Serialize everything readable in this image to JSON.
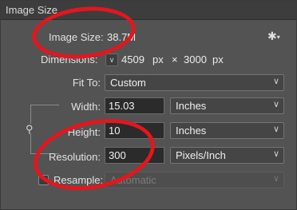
{
  "window": {
    "title": "Image Size"
  },
  "image_size": {
    "label": "Image Size:",
    "value": "38.7M"
  },
  "settings": {
    "icon": "gear-icon"
  },
  "dimensions": {
    "label": "Dimensions:",
    "width": "4509",
    "unit1": "px",
    "times": "×",
    "height": "3000",
    "unit2": "px"
  },
  "fit_to": {
    "label": "Fit To:",
    "value": "Custom"
  },
  "width": {
    "label": "Width:",
    "value": "15.03",
    "unit": "Inches"
  },
  "height": {
    "label": "Height:",
    "value": "10",
    "unit": "Inches"
  },
  "resolution": {
    "label": "Resolution:",
    "value": "300",
    "unit": "Pixels/Inch"
  },
  "resample": {
    "label": "Resample:",
    "value": "Automatic",
    "checked": false
  },
  "annotation": {
    "color": "#e3161e"
  }
}
